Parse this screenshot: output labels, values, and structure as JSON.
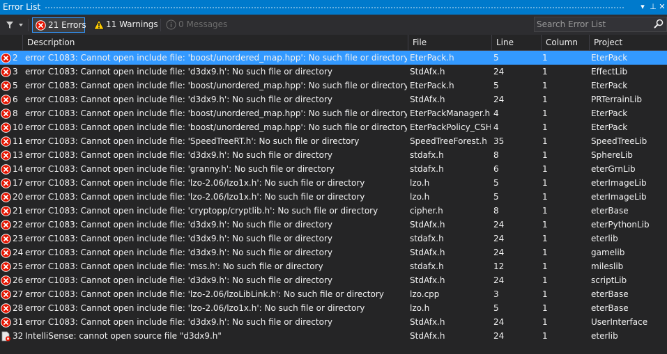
{
  "window": {
    "title": "Error List",
    "dropdown_glyph": "▾",
    "pin_glyph": "⊥",
    "close_glyph": "✕"
  },
  "toolbar": {
    "errors_label": "21 Errors",
    "warnings_label": "11 Warnings",
    "messages_label": "0 Messages",
    "search_placeholder": "Search Error List"
  },
  "columns": {
    "description": "Description",
    "file": "File",
    "line": "Line",
    "column": "Column",
    "project": "Project"
  },
  "rows": [
    {
      "num": "2",
      "desc": "error C1083: Cannot open include file: 'boost/unordered_map.hpp': No such file or directory",
      "file": "EterPack.h",
      "line": "5",
      "col": "1",
      "project": "EterPack",
      "icon": "error-icon",
      "selected": true
    },
    {
      "num": "3",
      "desc": "error C1083: Cannot open include file: 'd3dx9.h': No such file or directory",
      "file": "StdAfx.h",
      "line": "24",
      "col": "1",
      "project": "EffectLib",
      "icon": "error-icon"
    },
    {
      "num": "5",
      "desc": "error C1083: Cannot open include file: 'boost/unordered_map.hpp': No such file or directory",
      "file": "EterPack.h",
      "line": "5",
      "col": "1",
      "project": "EterPack",
      "icon": "error-icon"
    },
    {
      "num": "6",
      "desc": "error C1083: Cannot open include file: 'd3dx9.h': No such file or directory",
      "file": "StdAfx.h",
      "line": "24",
      "col": "1",
      "project": "PRTerrainLib",
      "icon": "error-icon"
    },
    {
      "num": "8",
      "desc": "error C1083: Cannot open include file: 'boost/unordered_map.hpp': No such file or directory",
      "file": "EterPackManager.h",
      "line": "4",
      "col": "1",
      "project": "EterPack",
      "icon": "error-icon"
    },
    {
      "num": "10",
      "desc": "error C1083: Cannot open include file: 'boost/unordered_map.hpp': No such file or directory",
      "file": "EterPackPolicy_CSHybr",
      "line": "4",
      "col": "1",
      "project": "EterPack",
      "icon": "error-icon"
    },
    {
      "num": "11",
      "desc": "error C1083: Cannot open include file: 'SpeedTreeRT.h': No such file or directory",
      "file": "SpeedTreeForest.h",
      "line": "35",
      "col": "1",
      "project": "SpeedTreeLib",
      "icon": "error-icon"
    },
    {
      "num": "13",
      "desc": "error C1083: Cannot open include file: 'd3dx9.h': No such file or directory",
      "file": "stdafx.h",
      "line": "8",
      "col": "1",
      "project": "SphereLib",
      "icon": "error-icon"
    },
    {
      "num": "14",
      "desc": "error C1083: Cannot open include file: 'granny.h': No such file or directory",
      "file": "stdafx.h",
      "line": "6",
      "col": "1",
      "project": "eterGrnLib",
      "icon": "error-icon"
    },
    {
      "num": "17",
      "desc": "error C1083: Cannot open include file: 'lzo-2.06/lzo1x.h': No such file or directory",
      "file": "lzo.h",
      "line": "5",
      "col": "1",
      "project": "eterImageLib",
      "icon": "error-icon"
    },
    {
      "num": "20",
      "desc": "error C1083: Cannot open include file: 'lzo-2.06/lzo1x.h': No such file or directory",
      "file": "lzo.h",
      "line": "5",
      "col": "1",
      "project": "eterImageLib",
      "icon": "error-icon"
    },
    {
      "num": "21",
      "desc": "error C1083: Cannot open include file: 'cryptopp/cryptlib.h': No such file or directory",
      "file": "cipher.h",
      "line": "8",
      "col": "1",
      "project": "eterBase",
      "icon": "error-icon"
    },
    {
      "num": "22",
      "desc": "error C1083: Cannot open include file: 'd3dx9.h': No such file or directory",
      "file": "StdAfx.h",
      "line": "24",
      "col": "1",
      "project": "eterPythonLib",
      "icon": "error-icon"
    },
    {
      "num": "23",
      "desc": "error C1083: Cannot open include file: 'd3dx9.h': No such file or directory",
      "file": "stdafx.h",
      "line": "24",
      "col": "1",
      "project": "eterlib",
      "icon": "error-icon"
    },
    {
      "num": "24",
      "desc": "error C1083: Cannot open include file: 'd3dx9.h': No such file or directory",
      "file": "StdAfx.h",
      "line": "24",
      "col": "1",
      "project": "gamelib",
      "icon": "error-icon"
    },
    {
      "num": "25",
      "desc": "error C1083: Cannot open include file: 'mss.h': No such file or directory",
      "file": "stdafx.h",
      "line": "12",
      "col": "1",
      "project": "mileslib",
      "icon": "error-icon"
    },
    {
      "num": "26",
      "desc": "error C1083: Cannot open include file: 'd3dx9.h': No such file or directory",
      "file": "StdAfx.h",
      "line": "24",
      "col": "1",
      "project": "scriptLib",
      "icon": "error-icon"
    },
    {
      "num": "27",
      "desc": "error C1083: Cannot open include file: 'lzo-2.06/lzoLibLink.h': No such file or directory",
      "file": "lzo.cpp",
      "line": "3",
      "col": "1",
      "project": "eterBase",
      "icon": "error-icon"
    },
    {
      "num": "28",
      "desc": "error C1083: Cannot open include file: 'lzo-2.06/lzo1x.h': No such file or directory",
      "file": "lzo.h",
      "line": "5",
      "col": "1",
      "project": "eterBase",
      "icon": "error-icon"
    },
    {
      "num": "31",
      "desc": "error C1083: Cannot open include file: 'd3dx9.h': No such file or directory",
      "file": "StdAfx.h",
      "line": "24",
      "col": "1",
      "project": "UserInterface",
      "icon": "error-icon"
    },
    {
      "num": "32",
      "desc": "IntelliSense: cannot open source file \"d3dx9.h\"",
      "file": "StdAfx.h",
      "line": "24",
      "col": "1",
      "project": "eterlib",
      "icon": "intellisense-error-icon"
    }
  ],
  "colors": {
    "accent": "#007acc",
    "selection": "#3399ff",
    "error": "#e51400",
    "warning": "#ffcc00",
    "background": "#252526"
  }
}
